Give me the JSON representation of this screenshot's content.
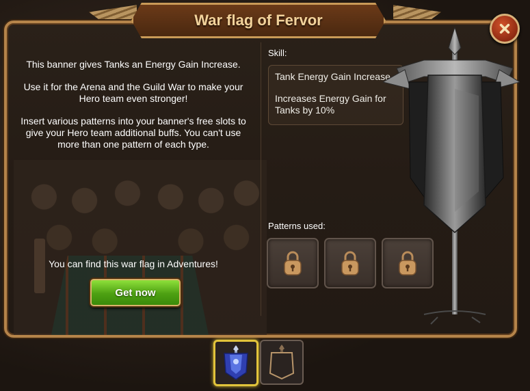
{
  "window": {
    "title": "War flag of Fervor",
    "close_icon": "close-icon"
  },
  "description": {
    "para1": "This banner gives Tanks an Energy Gain Increase.",
    "para2": "Use it for the Arena and the Guild War to make your Hero team even stronger!",
    "para3": "Insert various patterns into your banner's free slots to give your Hero team additional buffs. You can't use more than one pattern of each type."
  },
  "acquire": {
    "hint": "You can find this war flag in Adventures!",
    "button_label": "Get now"
  },
  "skill": {
    "label": "Skill:",
    "name": "Tank Energy Gain Increase",
    "description": "Increases Energy Gain for Tanks by 10%"
  },
  "patterns": {
    "label": "Patterns used:",
    "slots": [
      "lock-icon",
      "lock-icon",
      "lock-icon"
    ]
  },
  "banner_tabs": [
    {
      "icon": "blue-banner-icon",
      "selected": true
    },
    {
      "icon": "bronze-banner-icon",
      "selected": false
    }
  ],
  "colors": {
    "frame_gold": "#b5844a",
    "button_green": "#4da012",
    "close_red": "#c0451f",
    "selected_tab": "#e2c43b"
  }
}
